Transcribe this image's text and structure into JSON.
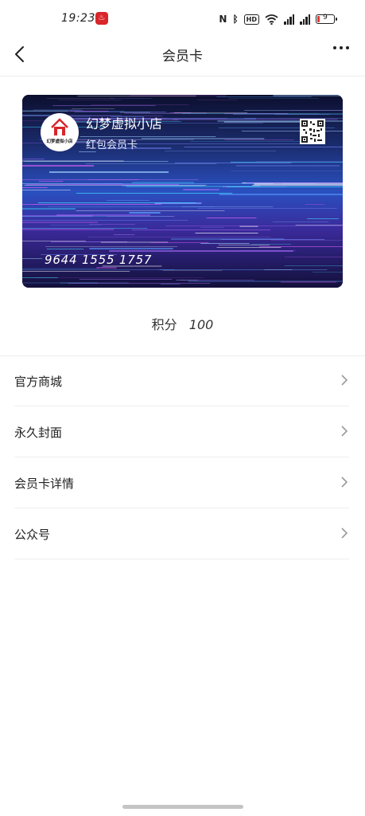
{
  "status_bar": {
    "time": "19:23",
    "battery_level": "9"
  },
  "nav": {
    "title": "会员卡"
  },
  "card": {
    "shop_name": "幻梦虚拟小店",
    "logo_text": "幻梦虚拟小店",
    "card_type": "红包会员卡",
    "card_number": "9644 1555 1757"
  },
  "points": {
    "label": "积分",
    "value": "100"
  },
  "menu": {
    "items": [
      {
        "label": "官方商城"
      },
      {
        "label": "永久封面"
      },
      {
        "label": "会员卡详情"
      },
      {
        "label": "公众号"
      }
    ]
  },
  "colors": {
    "accent_red": "#d8262a",
    "card_bg": "#0a1030"
  }
}
